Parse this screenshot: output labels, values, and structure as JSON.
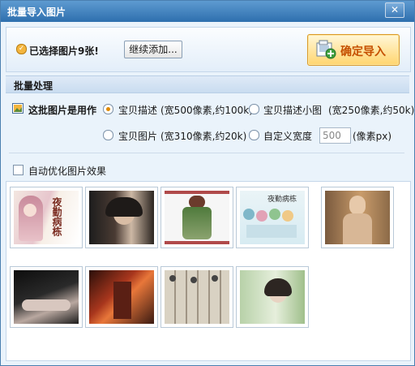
{
  "window": {
    "title": "批量导入图片",
    "close_label": "✕"
  },
  "top": {
    "selected_text": "已选择图片9张!",
    "add_more_label": "继续添加...",
    "confirm_label": "确定导入"
  },
  "batch": {
    "section_label": "批量处理",
    "use_label": "这批图片是用作",
    "options": [
      {
        "label": "宝贝描述",
        "hint": "(宽500像素,约100k)",
        "selected": true
      },
      {
        "label": "宝贝描述小图",
        "hint": "(宽250像素,约50k)",
        "selected": false
      },
      {
        "label": "宝贝图片",
        "hint": "(宽310像素,约20k)",
        "selected": false
      },
      {
        "label": "自定义宽度",
        "hint": "(像素px)",
        "selected": false
      }
    ],
    "custom_width_value": "500",
    "auto_optimize_label": "自动优化图片效果"
  },
  "thumbnails": [
    {
      "name": "thumb-1-anime-girl-calligraphy",
      "text": "夜勤病栋"
    },
    {
      "name": "thumb-2-woman-headphones",
      "text": ""
    },
    {
      "name": "thumb-3-anime-green-outfit",
      "text": ""
    },
    {
      "name": "thumb-4-chibi-group",
      "text": "夜勤病栋"
    },
    {
      "name": "thumb-5-woman-portrait",
      "text": ""
    },
    {
      "name": "thumb-6-reclining-figure",
      "text": ""
    },
    {
      "name": "thumb-7-red-mecha",
      "text": ""
    },
    {
      "name": "thumb-8-manga-figures",
      "text": ""
    },
    {
      "name": "thumb-9-woman-headphones-green",
      "text": ""
    }
  ],
  "colors": {
    "title_bar": "#2e6fae",
    "accent_orange": "#f3b53e",
    "confirm_text": "#c55000"
  }
}
